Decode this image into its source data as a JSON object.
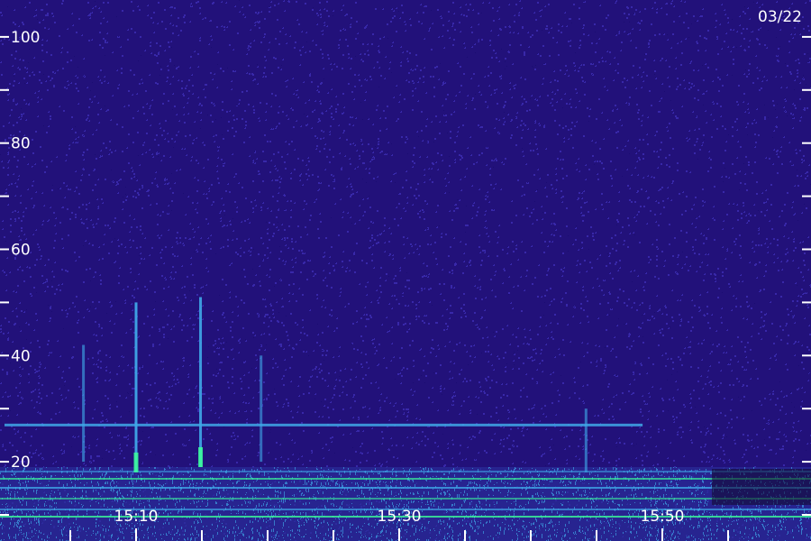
{
  "chart_data": {
    "type": "heatmap",
    "date_label": "03/22",
    "y_ticks": [
      {
        "value": 20,
        "label": "20"
      },
      {
        "value": 40,
        "label": "40"
      },
      {
        "value": 60,
        "label": "60"
      },
      {
        "value": 80,
        "label": "80"
      },
      {
        "value": 100,
        "label": "100"
      }
    ],
    "y_minor_ticks": [
      10,
      30,
      50,
      70,
      90
    ],
    "ylim": [
      5,
      105
    ],
    "x_ticks": [
      {
        "minutes": 10,
        "label": "15:10"
      },
      {
        "minutes": 30,
        "label": "15:30"
      },
      {
        "minutes": 50,
        "label": "15:50"
      }
    ],
    "x_minor_ticks": [
      5,
      15,
      20,
      25,
      35,
      40,
      45,
      55
    ],
    "xlim": [
      0,
      60
    ],
    "colors": {
      "background": "#22117a",
      "noise_low": "#1a0d70",
      "noise_high": "#4a3dd0",
      "band": "#3fa8e8",
      "intense": "#3cff9a",
      "labels": "#ffffff"
    },
    "features": {
      "horizontal_line": {
        "frequency": 27,
        "start_minutes": 0,
        "end_minutes": 48.5
      },
      "vertical_bursts": [
        {
          "minutes": 10.0,
          "freq_low": 18,
          "freq_high": 50,
          "intensity": 1.0
        },
        {
          "minutes": 14.9,
          "freq_low": 19,
          "freq_high": 51,
          "intensity": 0.9
        },
        {
          "minutes": 6.0,
          "freq_low": 20,
          "freq_high": 42,
          "intensity": 0.35
        },
        {
          "minutes": 19.5,
          "freq_low": 20,
          "freq_high": 40,
          "intensity": 0.3
        },
        {
          "minutes": 44.2,
          "freq_low": 18,
          "freq_high": 30,
          "intensity": 0.35
        }
      ],
      "low_band": {
        "freq_low": 5,
        "freq_high": 19
      }
    }
  }
}
